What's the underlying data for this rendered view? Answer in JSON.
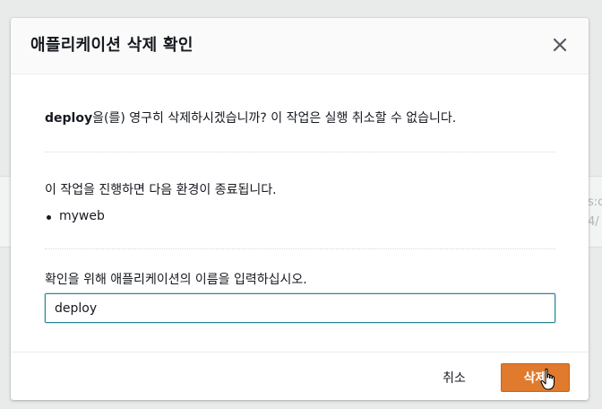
{
  "background": {
    "partial_text_1": "s:c",
    "partial_text_2": "4/"
  },
  "dialog": {
    "title": "애플리케이션 삭제 확인",
    "close_icon": "close-icon",
    "message_app_name": "deploy",
    "message_rest": "을(를) 영구히 삭제하시겠습니까? 이 작업은 실행 취소할 수 없습니다.",
    "env_intro": "이 작업을 진행하면 다음 환경이 종료됩니다.",
    "environments": [
      "myweb"
    ],
    "confirm_label": "확인을 위해 애플리케이션의 이름을 입력하십시오.",
    "confirm_input_value": "deploy",
    "cancel_label": "취소",
    "delete_label": "삭제",
    "colors": {
      "accent_border": "#2a8996",
      "delete_button": "#e07a2c"
    }
  }
}
